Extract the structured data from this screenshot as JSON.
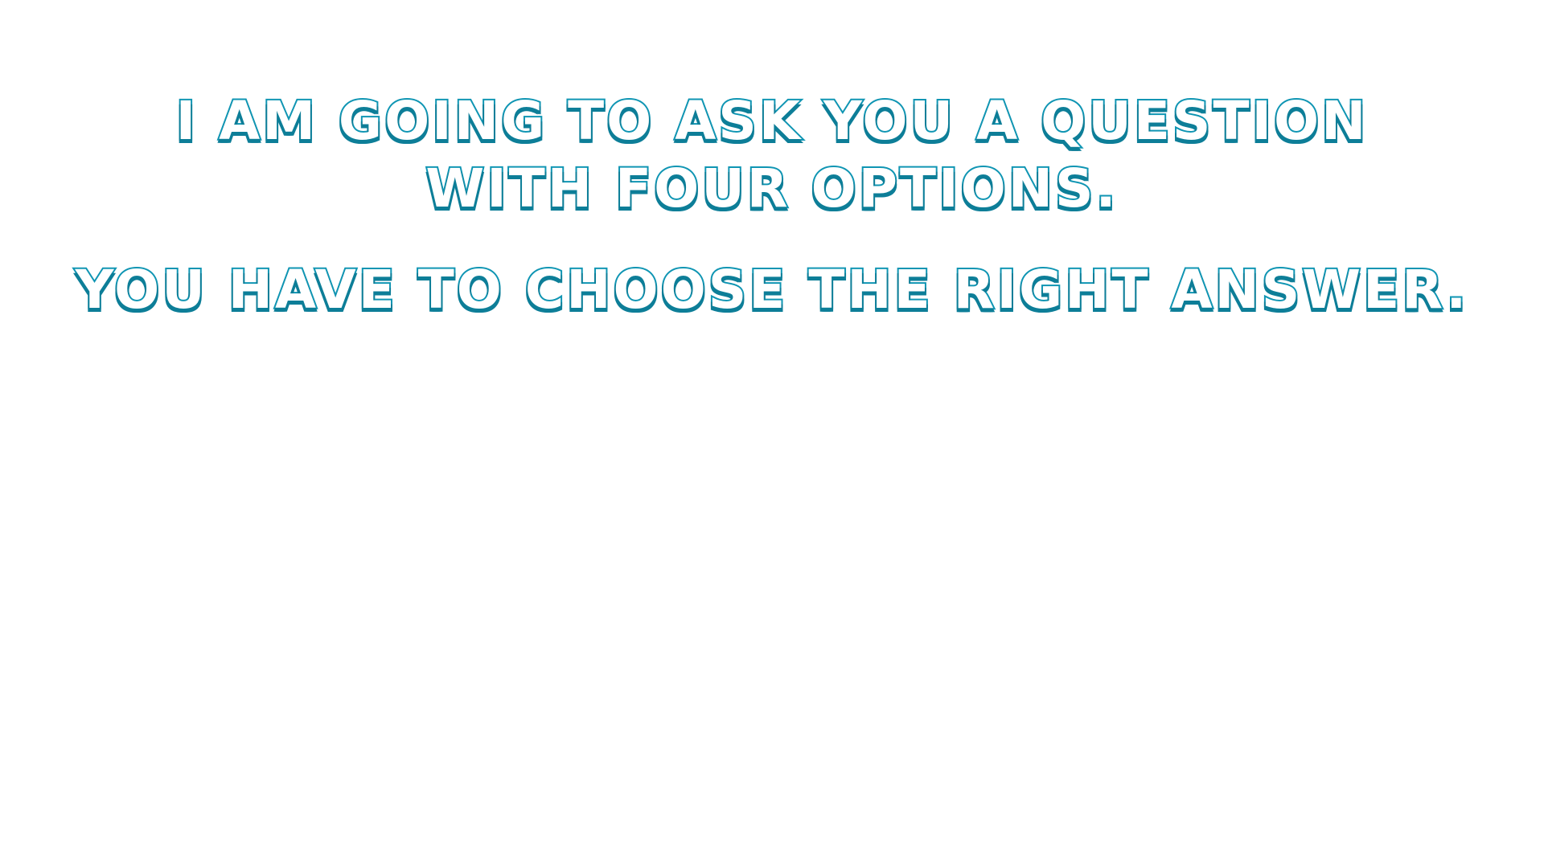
{
  "instructions": {
    "line1": "I AM GOING TO ASK YOU A QUESTION",
    "line2": "WITH FOUR OPTIONS.",
    "line3": "YOU HAVE TO CHOOSE THE RIGHT ANSWER."
  },
  "colors": {
    "text_outline": "#0f95b3",
    "text_shadow": "#0d7e98",
    "text_fill": "#ffffff",
    "background": "#ffffff"
  }
}
